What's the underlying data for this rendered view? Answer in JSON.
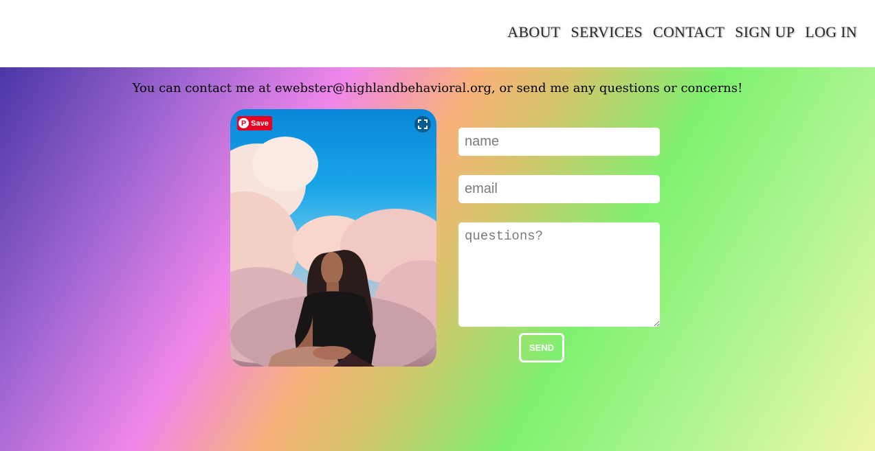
{
  "nav": {
    "items": [
      {
        "label": "ABOUT"
      },
      {
        "label": "SERVICES"
      },
      {
        "label": "CONTACT"
      },
      {
        "label": "SIGN UP"
      },
      {
        "label": "LOG IN"
      }
    ]
  },
  "main": {
    "message": "You can contact me at ewebster@highlandbehavioral.org, or send me any questions or concerns!"
  },
  "photo": {
    "pin_label": "Save"
  },
  "form": {
    "name_placeholder": "name",
    "email_placeholder": "email",
    "questions_placeholder": "questions?",
    "send_label": "SEND"
  }
}
